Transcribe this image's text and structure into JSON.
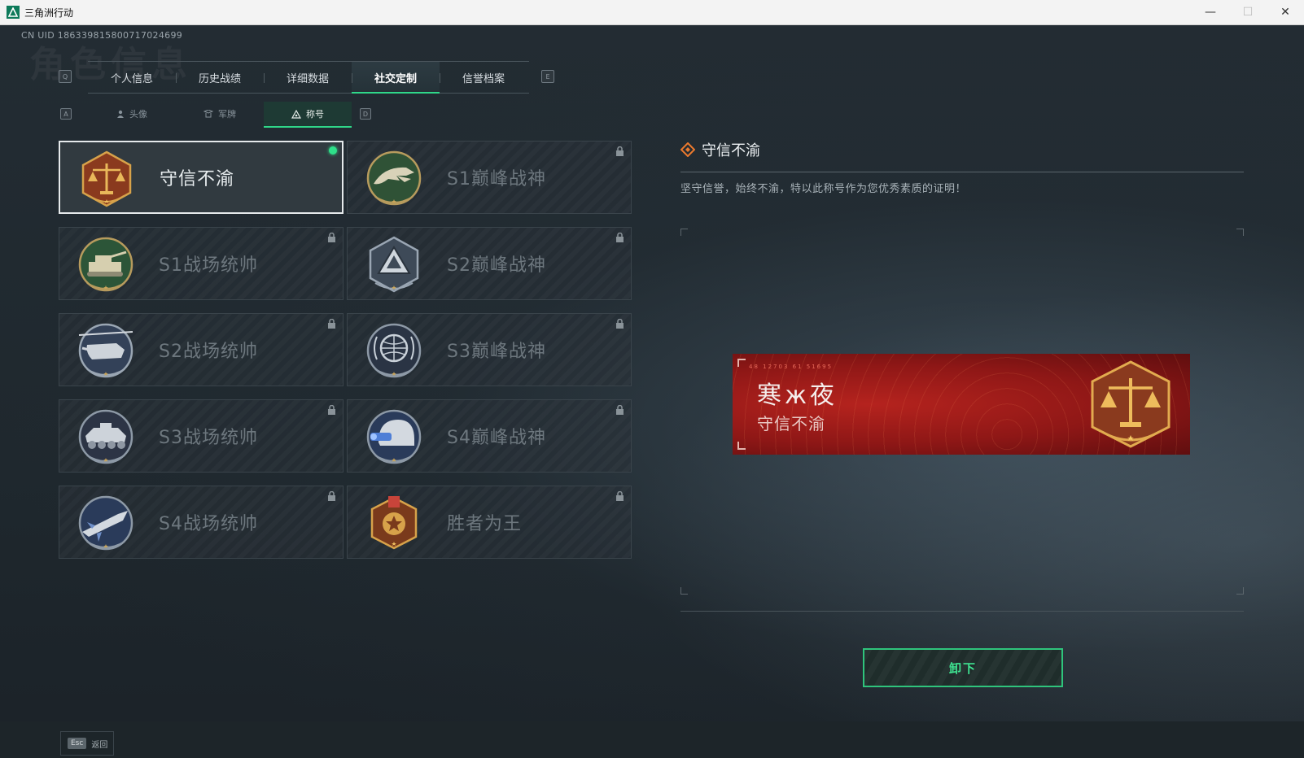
{
  "window": {
    "title": "三角洲行动",
    "minimize_glyph": "—",
    "maximize_glyph": "☐",
    "close_glyph": "✕"
  },
  "uid_text": "CN UID 1863398158007170246​99",
  "watermark": "角色信息",
  "main_tabs": {
    "prev_key": "Q",
    "next_key": "E",
    "items": [
      {
        "label": "个人信息",
        "active": false
      },
      {
        "label": "历史战绩",
        "active": false
      },
      {
        "label": "详细数据",
        "active": false
      },
      {
        "label": "社交定制",
        "active": true
      },
      {
        "label": "信誉档案",
        "active": false
      }
    ]
  },
  "sub_tabs": {
    "prev_key": "A",
    "next_key": "D",
    "items": [
      {
        "label": "头像",
        "icon": "person-icon",
        "active": false
      },
      {
        "label": "军牌",
        "icon": "badge-icon",
        "active": false
      },
      {
        "label": "称号",
        "icon": "triangle-icon",
        "active": true
      }
    ]
  },
  "titles": [
    {
      "label": "守信不渝",
      "emblem": "scales-emblem",
      "locked": false,
      "selected": true
    },
    {
      "label": "S1巅峰战神",
      "emblem": "crocodile-emblem",
      "locked": true,
      "selected": false
    },
    {
      "label": "S1战场统帅",
      "emblem": "tank-emblem",
      "locked": true,
      "selected": false
    },
    {
      "label": "S2巅峰战神",
      "emblem": "triangle-emblem",
      "locked": true,
      "selected": false
    },
    {
      "label": "S2战场统帅",
      "emblem": "helicopter-emblem",
      "locked": true,
      "selected": false
    },
    {
      "label": "S3巅峰战神",
      "emblem": "globe-emblem",
      "locked": true,
      "selected": false
    },
    {
      "label": "S3战场统帅",
      "emblem": "apc-emblem",
      "locked": true,
      "selected": false
    },
    {
      "label": "S4巅峰战神",
      "emblem": "helmet-emblem",
      "locked": true,
      "selected": false
    },
    {
      "label": "S4战场统帅",
      "emblem": "missile-emblem",
      "locked": true,
      "selected": false
    },
    {
      "label": "胜者为王",
      "emblem": "medal-emblem",
      "locked": true,
      "selected": false
    }
  ],
  "detail": {
    "title": "守信不渝",
    "description": "坚守信誉，始终不渝，特以此称号作为您优秀素质的证明！"
  },
  "banner": {
    "meta": "48 12703  61 51695",
    "player_name": "寒ж夜",
    "title": "守信不渝"
  },
  "unequip_button": "卸下",
  "footer": {
    "esc_key": "Esc",
    "esc_label": "返回"
  },
  "colors": {
    "accent": "#2fd889",
    "banner_red": "#a11c1a",
    "emblem_gold": "#d7a24a",
    "emblem_bronze": "#8a3a1e"
  }
}
